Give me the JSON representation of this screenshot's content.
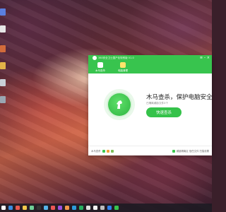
{
  "app": {
    "title": "360安全卫士国产化特别版 V1.0",
    "tabs": [
      {
        "label": "木马查杀",
        "icon": "horse-icon"
      },
      {
        "label": "电脑清理",
        "icon": "broom-icon"
      }
    ],
    "headline": "木马查杀，保护电脑安全",
    "subline": "已隔离威胁文件0个",
    "scan_button": "快速查杀",
    "footer_left_text": "木马查杀",
    "footer_right_text": "威胁隔离区 信任文件 扫描设置"
  },
  "colors": {
    "brand_green": "#38c44e",
    "button_green": "#35c24a"
  },
  "taskbar_icons": [
    "launcher-icon",
    "browser-icon",
    "files-icon",
    "settings-icon",
    "store-icon",
    "terminal-icon",
    "security-icon",
    "music-icon",
    "video-icon",
    "photos-icon",
    "mail-icon",
    "chat-icon",
    "calendar-icon",
    "notes-icon",
    "trash-icon",
    "office-icon",
    "360-icon"
  ],
  "desktop_icons": [
    "app-icon-1",
    "app-icon-2",
    "app-icon-3",
    "app-icon-4",
    "app-icon-5",
    "app-icon-6"
  ]
}
